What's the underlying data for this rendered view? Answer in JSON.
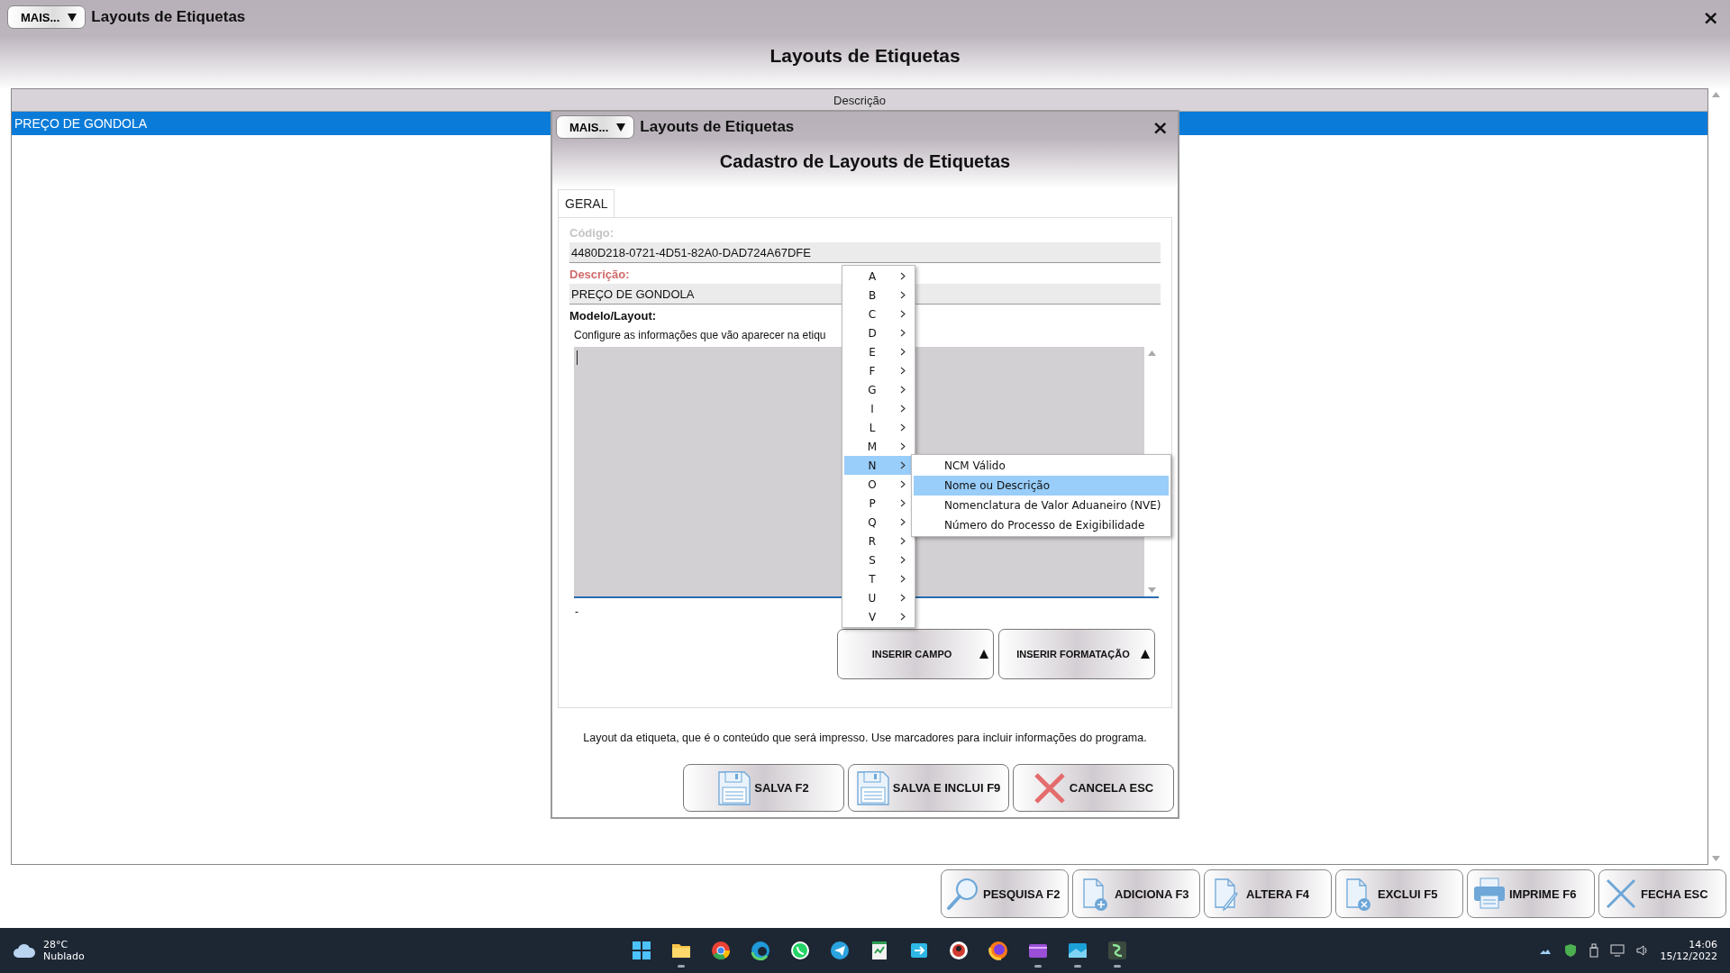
{
  "window": {
    "menu_button": "MAIS...",
    "title": "Layouts de Etiquetas",
    "close": "×"
  },
  "page_title": "Layouts de Etiquetas",
  "table": {
    "columns": [
      "Descrição"
    ],
    "rows": [
      {
        "cells": [
          "PREÇO DE GONDOLA"
        ],
        "selected": true
      }
    ]
  },
  "toolbar": [
    {
      "label": "PESQUISA F2",
      "kind": "search"
    },
    {
      "label": "ADICIONA F3",
      "kind": "add"
    },
    {
      "label": "ALTERA F4",
      "kind": "edit"
    },
    {
      "label": "EXCLUI F5",
      "kind": "delete"
    },
    {
      "label": "IMPRIME F6",
      "kind": "print"
    },
    {
      "label": "FECHA ESC",
      "kind": "close"
    }
  ],
  "dialog": {
    "menu_button": "MAIS...",
    "title": "Layouts de Etiquetas",
    "close": "×",
    "heading": "Cadastro de Layouts de Etiquetas",
    "tabs": [
      {
        "label": "GERAL",
        "selected": true
      }
    ],
    "fields": [
      {
        "label": "Código:",
        "value": "4480D218-0721-4D51-82A0-DAD724A67DFE",
        "disabled": true
      },
      {
        "label": "Descrição:",
        "value": "PREÇO DE GONDOLA",
        "disabled": false
      }
    ],
    "layout_label": "Modelo/Layout:",
    "layout_hint": "Configure as informações que vão aparecer na etiqu",
    "layout_footer": "-",
    "insert_buttons": [
      "INSERIR CAMPO",
      "INSERIR FORMATAÇÃO"
    ],
    "help": "Layout da etiqueta, que é o conteúdo que será impresso. Use marcadores para incluir informações do programa.",
    "buttons": [
      {
        "label": "SALVA F2",
        "kind": "save"
      },
      {
        "label": "SALVA E INCLUI F9",
        "kind": "save"
      },
      {
        "label": "CANCELA ESC",
        "kind": "cancel"
      }
    ]
  },
  "field_menu": {
    "items": [
      {
        "label": "A",
        "selected": false
      },
      {
        "label": "B",
        "selected": false
      },
      {
        "label": "C",
        "selected": false
      },
      {
        "label": "D",
        "selected": false
      },
      {
        "label": "E",
        "selected": false
      },
      {
        "label": "F",
        "selected": false
      },
      {
        "label": "G",
        "selected": false
      },
      {
        "label": "I",
        "selected": false
      },
      {
        "label": "L",
        "selected": false
      },
      {
        "label": "M",
        "selected": false
      },
      {
        "label": "N",
        "selected": true
      },
      {
        "label": "O",
        "selected": false
      },
      {
        "label": "P",
        "selected": false
      },
      {
        "label": "Q",
        "selected": false
      },
      {
        "label": "R",
        "selected": false
      },
      {
        "label": "S",
        "selected": false
      },
      {
        "label": "T",
        "selected": false
      },
      {
        "label": "U",
        "selected": false
      },
      {
        "label": "V",
        "selected": false
      }
    ],
    "submenu": [
      {
        "label": "NCM Válido",
        "selected": false
      },
      {
        "label": "Nome ou Descrição",
        "selected": true
      },
      {
        "label": "Nomenclatura de Valor Aduaneiro (NVE)",
        "selected": false
      },
      {
        "label": "Número do Processo de Exigibilidade",
        "selected": false
      }
    ]
  },
  "taskbar": {
    "weather": {
      "temperature": "28°C",
      "condition": "Nublado"
    },
    "apps": [
      {
        "kind": "start",
        "running": false
      },
      {
        "kind": "folder",
        "running": true
      },
      {
        "kind": "chrome",
        "running": false
      },
      {
        "kind": "edge",
        "running": false
      },
      {
        "kind": "whatsapp",
        "running": false
      },
      {
        "kind": "telegram",
        "running": false
      },
      {
        "kind": "sheet",
        "running": false
      },
      {
        "kind": "transfer",
        "running": false
      },
      {
        "kind": "round",
        "running": false
      },
      {
        "kind": "firefox",
        "running": false
      },
      {
        "kind": "media",
        "running": true
      },
      {
        "kind": "mail",
        "running": true
      },
      {
        "kind": "system",
        "running": true
      }
    ],
    "time": "14:06",
    "date": "15/12/2022"
  }
}
